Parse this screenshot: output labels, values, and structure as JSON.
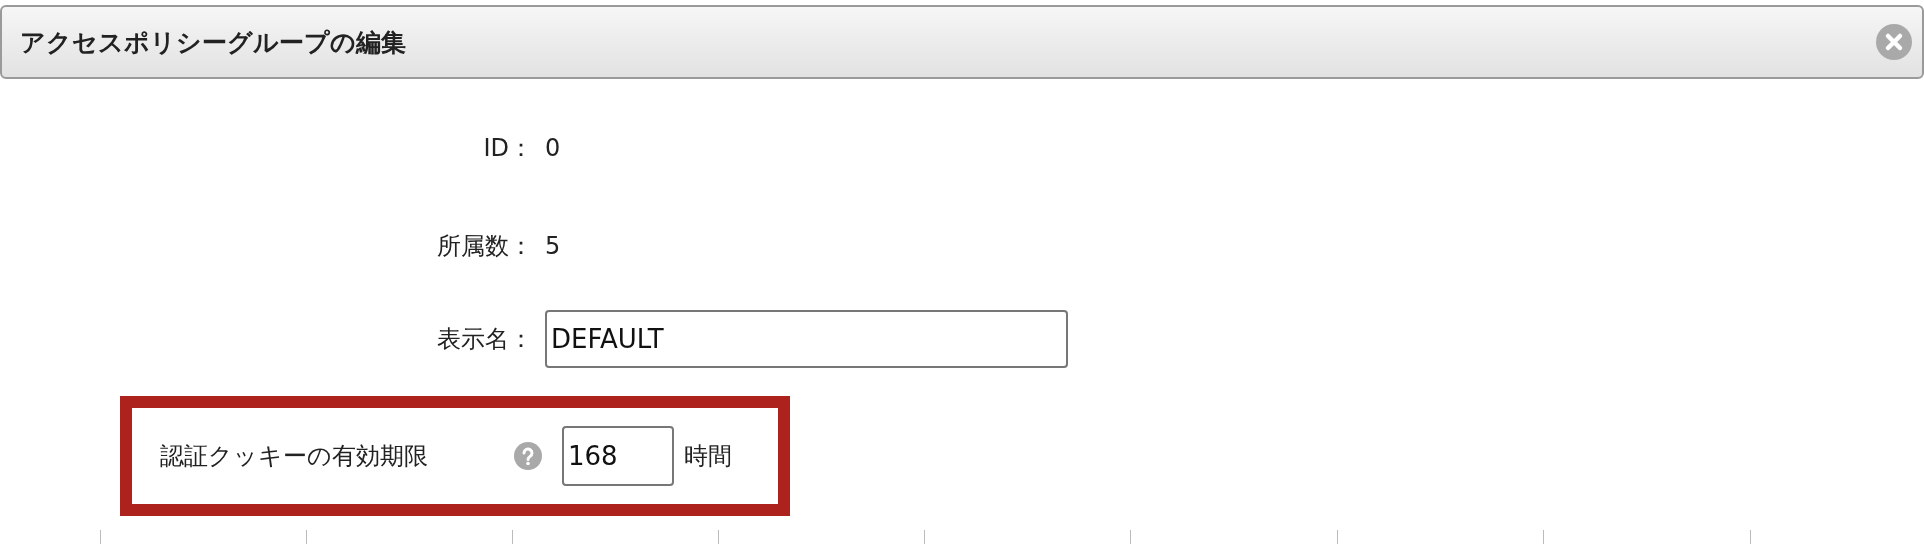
{
  "dialog": {
    "title": "アクセスポリシーグループの編集"
  },
  "fields": [
    {
      "kind": "text",
      "label": "ID",
      "separator": "：",
      "value": "0"
    },
    {
      "kind": "text",
      "label": "所属数",
      "separator": "：",
      "value": "5"
    },
    {
      "kind": "input",
      "label": "表示名",
      "separator": "：",
      "value": "DEFAULT"
    }
  ],
  "cookie_expiry": {
    "label": "認証クッキーの有効期限",
    "value": "168",
    "unit": "時間",
    "highlighted": true
  }
}
